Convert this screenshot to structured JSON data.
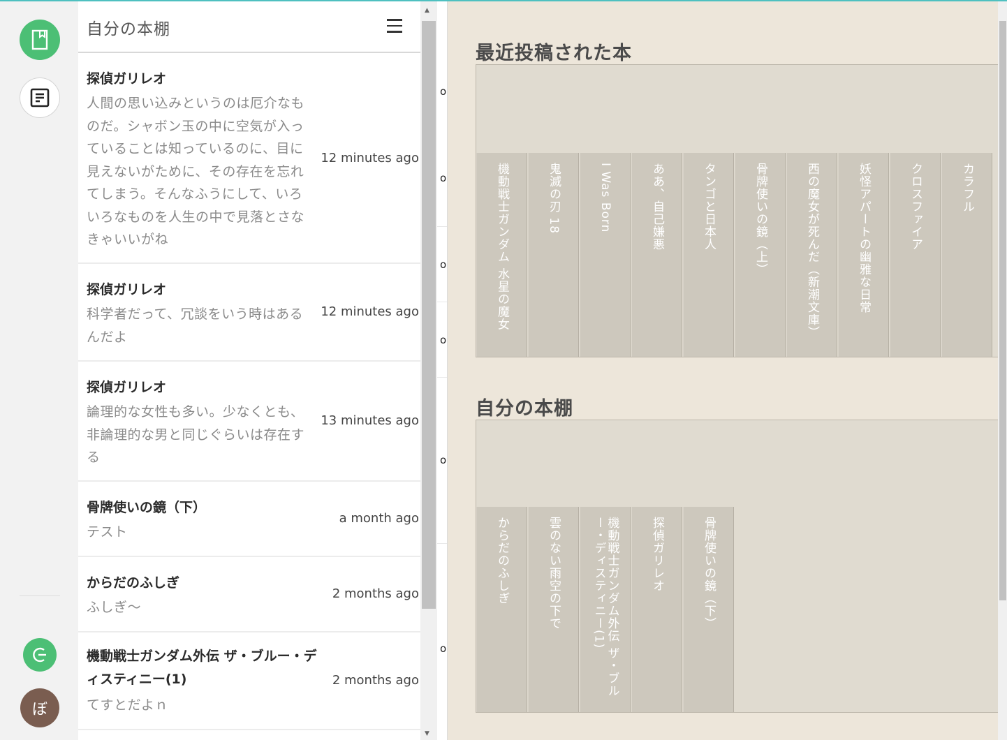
{
  "rail": {
    "avatar_letter": "ぼ"
  },
  "panel": {
    "title": "自分の本棚",
    "posts": [
      {
        "title": "探偵ガリレオ",
        "body": "人間の思い込みというのは厄介なものだ。シャボン玉の中に空気が入っていることは知っているのに、目に見えないがために、その存在を忘れてしまう。そんなふうにして、いろいろなものを人生の中で見落とさなきゃいいがね",
        "time": "12 minutes ago"
      },
      {
        "title": "探偵ガリレオ",
        "body": "科学者だって、冗談をいう時はあるんだよ",
        "time": "12 minutes ago"
      },
      {
        "title": "探偵ガリレオ",
        "body": "論理的な女性も多い。少なくとも、非論理的な男と同じぐらいは存在する",
        "time": "13 minutes ago"
      },
      {
        "title": "骨牌使いの鏡（下）",
        "body": "テスト",
        "time": "a month ago"
      },
      {
        "title": "からだのふしぎ",
        "body": "ふしぎ〜",
        "time": "2 months ago"
      },
      {
        "title": "機動戦士ガンダム外伝 ザ・ブルー・ディスティニー(1)",
        "body": "てすとだよｎ",
        "time": "2 months ago"
      }
    ]
  },
  "gutter": {
    "mark": "o"
  },
  "main": {
    "recent_title": "最近投稿された本",
    "recent_books": [
      "機動戦士ガンダム 水星の魔女",
      "鬼滅の刃 18",
      "I Was Born",
      "ああ、自己嫌悪",
      "タンゴと日本人",
      "骨牌使いの鏡（上）",
      "西の魔女が死んだ（新潮文庫）",
      "妖怪アパートの幽雅な日常",
      "クロスファイア",
      "カラフル"
    ],
    "mine_title": "自分の本棚",
    "my_books": [
      "からだのふしぎ",
      "雲のない雨空の下で",
      "機動戦士ガンダム外伝 ザ・ブルー・ディスティニー(1)",
      "探偵ガリレオ",
      "骨牌使いの鏡（下）"
    ]
  },
  "colors": {
    "accent": "#4cbf75",
    "background": "#ede6da",
    "book": "#cdc8bd"
  }
}
